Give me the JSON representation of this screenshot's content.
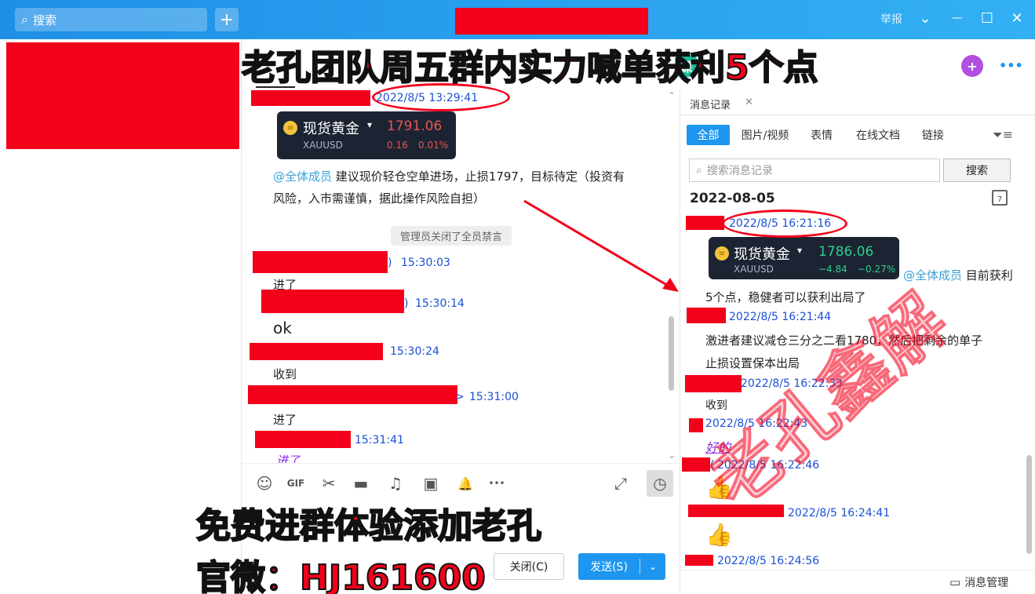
{
  "titlebar": {
    "search_placeholder": "搜索",
    "plus": "+",
    "report": "举报",
    "chevron": "⌄",
    "minimize": "—",
    "maximize": "☐",
    "close": "✕"
  },
  "overlay": {
    "headline": "老孔团队周五群内实力喊单获利5个点",
    "promo_line1": "免费进群体验添加老孔",
    "promo_line2": "官微：HJ161600",
    "watermark": "老孔鑫解"
  },
  "chat": {
    "messages": [
      {
        "time": "2022/8/5 13:29:41"
      },
      {
        "text_mention": "@全体成员",
        "text_line1": "建议现价轻仓空单进场，止损1797，目标待定（投资有",
        "text_line2": "风险，入市需谨慎，据此操作风险自担）"
      },
      {
        "time": "15:30:03",
        "prefix": ")",
        "text": "进了"
      },
      {
        "time": "15:30:14",
        "prefix": ")",
        "text": "ok"
      },
      {
        "time": "15:30:24",
        "text": "收到"
      },
      {
        "time": "15:31:00",
        "prefix": ">",
        "text": "进了"
      },
      {
        "time": "15:31:41",
        "text": "进了"
      }
    ],
    "system_note": "管理员关闭了全员禁言",
    "gold_card": {
      "name": "现货黄金",
      "code": "XAUUSD",
      "price": "1791.06",
      "change": "0.16",
      "change_pct": "0.01%"
    }
  },
  "toolbar": {
    "emoji": "☺",
    "gif": "GIF",
    "scissors": "✂",
    "folder": "▬",
    "music": "♫",
    "image": "▣",
    "bell": "🔔",
    "more": "•••",
    "expand": "⤢",
    "history": "◷"
  },
  "input": {
    "close_label": "关闭(C)",
    "send_label": "发送(S)",
    "send_arrow": "⌄"
  },
  "right_panel": {
    "tab_label": "消息记录",
    "tab_close": "✕",
    "filters": [
      "全部",
      "图片/视频",
      "表情",
      "在线文档",
      "链接"
    ],
    "search_placeholder": "搜索消息记录",
    "search_button": "搜索",
    "date": "2022-08-05",
    "calendar_day": "7",
    "records": [
      {
        "time": "2022/8/5 16:21:16"
      },
      {
        "mention": "@全体成员",
        "text_tail": "目前获利",
        "text_line2": "5个点，稳健者可以获利出局了"
      },
      {
        "time": "2022/8/5 16:21:44",
        "text_line1": "激进者建议减仓三分之二看1780，然后把剩余的单子",
        "text_line2": "止损设置保本出局"
      },
      {
        "time": "2022/8/5 16:22:33",
        "text": "收到"
      },
      {
        "time": "2022/8/5 16:22:43",
        "text": "好的"
      },
      {
        "time": "2022/8/5 16:22:46",
        "prefix": "("
      },
      {
        "time": "2022/8/5 16:24:41"
      },
      {
        "time": "2022/8/5 16:24:56"
      }
    ],
    "gold_card": {
      "name": "现货黄金",
      "code": "XAUUSD",
      "price": "1786.06",
      "change": "−4.84",
      "change_pct": "−0.27%"
    },
    "manage_label": "消息管理"
  },
  "header_icons": {
    "course": "课",
    "add": "+",
    "more": "•••"
  },
  "colors": {
    "accent": "#1e96f0",
    "redact": "#f3001b",
    "link_time": "#1a4fd6",
    "mention": "#3aa0d8",
    "up": "#e8554e",
    "down": "#2ed08b"
  }
}
